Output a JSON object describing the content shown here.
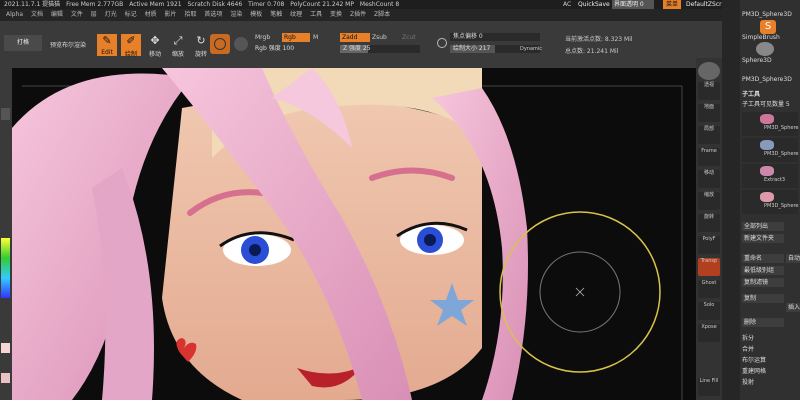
{
  "titlebar": {
    "version": "2021.11.7.1 提猫猫",
    "free_mem": "Free Mem 2.777GB",
    "active_mem": "Active Mem 1921",
    "scratch_disk": "Scratch Disk 4646",
    "timer": "Timer 0.708",
    "poly_count": "PolyCount 21.242 MP",
    "mesh_count": "MeshCount 8",
    "ac_label": "AC",
    "quicksave": "QuickSave",
    "transparency": "界面透明 0",
    "menu_label": "菜单",
    "script": "DefaultZScript"
  },
  "menu": [
    "Alpha",
    "文档",
    "编辑",
    "文件",
    "层",
    "灯光",
    "标记",
    "材质",
    "影片",
    "拾取",
    "首选项",
    "渲染",
    "模板",
    "笔触",
    "纹理",
    "工具",
    "变换",
    "Z插件",
    "Z脚本"
  ],
  "toolbar": {
    "open_label": "打格",
    "preview_label": "预览布尔渲染",
    "edit_label": "Edit",
    "draw_label": "绘制",
    "move_label": "移动",
    "scale_label": "缩放",
    "rotate_label": "旋转",
    "mrgb": "Mrgb",
    "rgb": "Rgb",
    "m": "M",
    "rgb_intensity": "Rgb 强度 100",
    "zadd": "Zadd",
    "zsub": "Zsub",
    "zcut": "Zcut",
    "z_intensity": "Z 强度 25",
    "focal_shift": "焦点偏移 0",
    "draw_size": "绘制大小 217",
    "dynamic": "Dynamic",
    "active_points": "当前激活点数: 8.323 Mil",
    "total_points": "总点数: 21.241 Mil"
  },
  "shelf": [
    "透视",
    "地面",
    "局部",
    "Frame",
    "移动",
    "缩放",
    "旋转",
    "PolyF",
    "Transp",
    "Ghost",
    "Solo",
    "Xpose",
    "Line Fill"
  ],
  "panel": {
    "simple_brush": "SimpleBrush",
    "sphere3d": "Sphere3D",
    "pm3d": "PM3D_Sphere3D",
    "subtool_header": "子工具",
    "visible_count": "子工具可见数量 5",
    "item1": "PM3D_Sphere",
    "item2": "PM3D_Sphere",
    "item3": "Extract3",
    "item4": "PM3D_Sphere",
    "list_all": "全部列出",
    "new_folder": "新建文件夹",
    "rename": "重命名",
    "auto": "自动",
    "min_sort": "最低级别组",
    "copy_filter": "复制滤镜",
    "copy": "复制",
    "append": "插入",
    "delete": "删除",
    "split": "拆分",
    "merge": "合并",
    "boolean": "布尔运算",
    "remesh": "重建网格",
    "project": "投射"
  }
}
